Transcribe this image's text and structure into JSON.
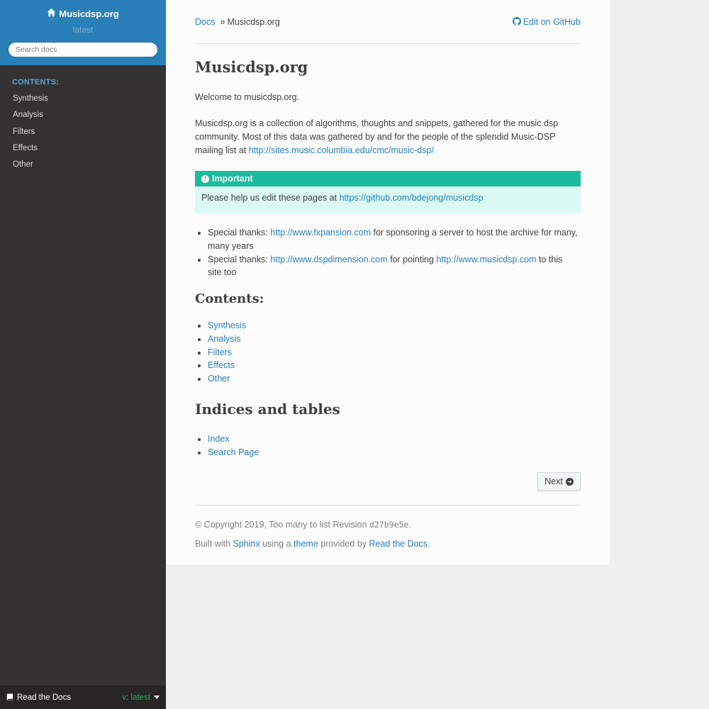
{
  "sidebar": {
    "project": "Musicdsp.org",
    "version": "latest",
    "search_placeholder": "Search docs",
    "caption": "CONTENTS:",
    "items": [
      {
        "label": "Synthesis"
      },
      {
        "label": "Analysis"
      },
      {
        "label": "Filters"
      },
      {
        "label": "Effects"
      },
      {
        "label": "Other"
      }
    ]
  },
  "rtd": {
    "label": "Read the Docs",
    "version": "v: latest"
  },
  "breadcrumb": {
    "docs": "Docs",
    "sep": "»",
    "current": "Musicdsp.org",
    "edit": "Edit on GitHub"
  },
  "page": {
    "title": "Musicdsp.org",
    "welcome": "Welcome to musicdsp.org.",
    "intro_lines": [
      "Musicdsp.org is a collection of algorithms, thoughts and snippets, gathered for the music dsp",
      "community. Most of this data was gathered by and for the people of the splendid Music-DSP"
    ],
    "intro_mailing": "mailing list at",
    "intro_link": "http://sites.music.columbia.edu/cmc/music-dsp/",
    "important": {
      "title": "Important",
      "text": "Please help us edit these pages at",
      "link": "https://github.com/bdejong/musicdsp"
    },
    "thanks": [
      {
        "prefix": "Special thanks:",
        "link": "http://www.fxpansion.com",
        "suffix": "for sponsoring a server to host the archive for many,",
        "line2": "many years"
      },
      {
        "prefix": "Special thanks:",
        "link": "http://www.dspdimension.com",
        "middle": "for pointing",
        "link2": "http://www.musicdsp.com",
        "suffix": "to this",
        "line2": "site too"
      }
    ],
    "contents_heading": "Contents:",
    "contents": [
      "Synthesis",
      "Analysis",
      "Filters",
      "Effects",
      "Other"
    ],
    "indices_heading": "Indices and tables",
    "indices": [
      "Index",
      "Search Page"
    ],
    "next": "Next"
  },
  "footer": {
    "copyright": "© Copyright 2019, Too many to list Revision",
    "revision": "d27b9e5e",
    "built_with": "Built with",
    "sphinx": "Sphinx",
    "using_a": "using a",
    "theme": "theme",
    "provided_by": "provided by",
    "rtd": "Read the Docs",
    "period": "."
  }
}
